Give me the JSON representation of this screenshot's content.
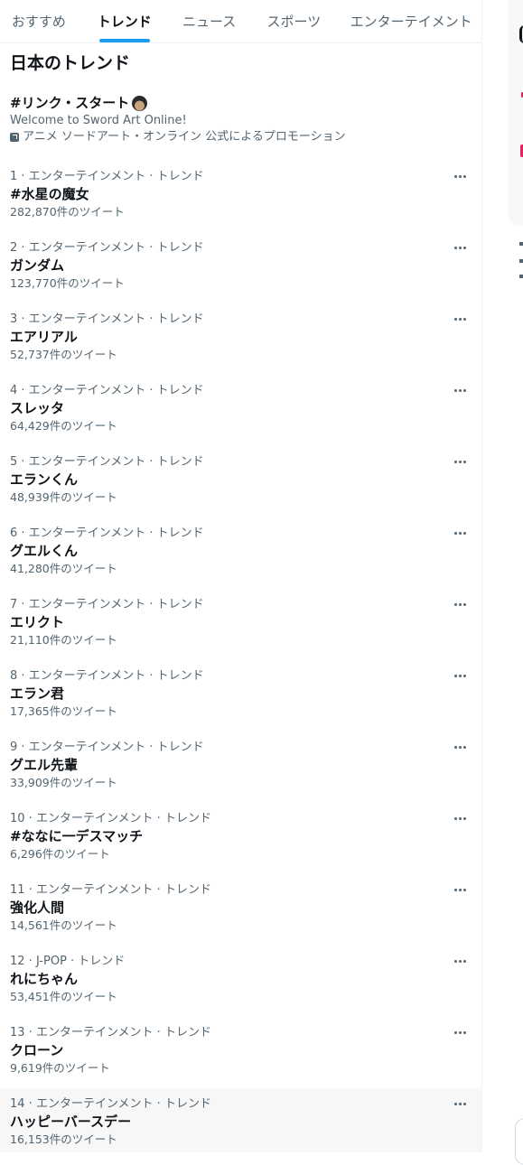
{
  "tabs": [
    {
      "label": "おすすめ",
      "active": false
    },
    {
      "label": "トレンド",
      "active": true
    },
    {
      "label": "ニュース",
      "active": false
    },
    {
      "label": "スポーツ",
      "active": false
    },
    {
      "label": "エンターテイメント",
      "active": false
    }
  ],
  "page_title": "日本のトレンド",
  "promoted": {
    "hashtag": "#リンク・スタート",
    "emoji": "person-emoji",
    "description": "Welcome to Sword Art Online!",
    "promoted_by": "アニメ ソードアート・オンライン 公式によるプロモーション"
  },
  "trends": [
    {
      "meta": "1 · エンターテインメント · トレンド",
      "name": "#水星の魔女",
      "count": "282,870件のツイート"
    },
    {
      "meta": "2 · エンターテインメント · トレンド",
      "name": "ガンダム",
      "count": "123,770件のツイート"
    },
    {
      "meta": "3 · エンターテインメント · トレンド",
      "name": "エアリアル",
      "count": "52,737件のツイート"
    },
    {
      "meta": "4 · エンターテインメント · トレンド",
      "name": "スレッタ",
      "count": "64,429件のツイート"
    },
    {
      "meta": "5 · エンターテインメント · トレンド",
      "name": "エランくん",
      "count": "48,939件のツイート"
    },
    {
      "meta": "6 · エンターテインメント · トレンド",
      "name": "グエルくん",
      "count": "41,280件のツイート"
    },
    {
      "meta": "7 · エンターテインメント · トレンド",
      "name": "エリクト",
      "count": "21,110件のツイート"
    },
    {
      "meta": "8 · エンターテインメント · トレンド",
      "name": "エラン君",
      "count": "17,365件のツイート"
    },
    {
      "meta": "9 · エンターテインメント · トレンド",
      "name": "グエル先輩",
      "count": "33,909件のツイート"
    },
    {
      "meta": "10 · エンターテインメント · トレンド",
      "name": "#ななに一デスマッチ",
      "count": "6,296件のツイート"
    },
    {
      "meta": "11 · エンターテインメント · トレンド",
      "name": "強化人間",
      "count": "14,561件のツイート"
    },
    {
      "meta": "12 · J-POP · トレンド",
      "name": "れにちゃん",
      "count": "53,451件のツイート"
    },
    {
      "meta": "13 · エンターテインメント · トレンド",
      "name": "クローン",
      "count": "9,619件のツイート"
    },
    {
      "meta": "14 · エンターテインメント · トレンド",
      "name": "ハッピーバースデー",
      "count": "16,153件のツイート",
      "hovered": true
    }
  ],
  "colors": {
    "accent": "#1d9bf0",
    "text_primary": "#0f1419",
    "text_secondary": "#536471",
    "hover_bg": "#f7f7f7",
    "border": "#eff3f4"
  }
}
